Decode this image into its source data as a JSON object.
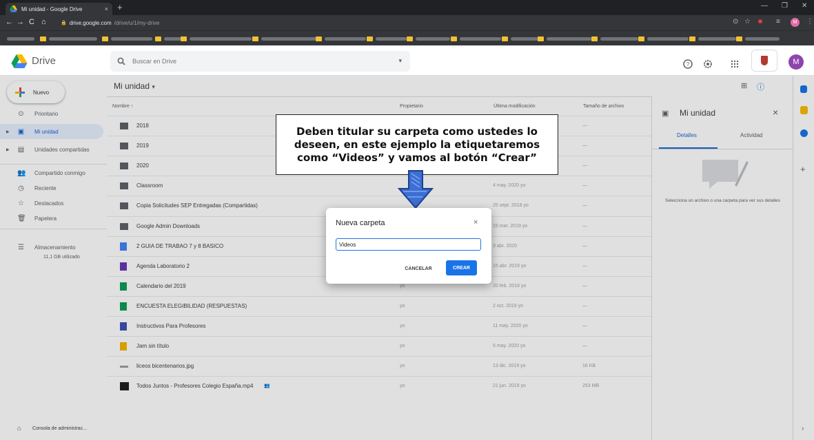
{
  "browser": {
    "tab_title": "Mi unidad - Google Drive",
    "tab_close": "×",
    "new_tab": "+",
    "url_host": "drive.google.com",
    "url_path": "/drive/u/1/my-drive",
    "profile_initial": "M"
  },
  "header": {
    "brand": "Drive",
    "search_placeholder": "Buscar en Drive",
    "user_initial": "M"
  },
  "sidebar": {
    "new_label": "Nuevo",
    "items": [
      {
        "label": "Prioritario",
        "icon": "check-circle-icon"
      },
      {
        "label": "Mi unidad",
        "icon": "my-drive-icon"
      },
      {
        "label": "Unidades compartidas",
        "icon": "shared-drives-icon"
      },
      {
        "label": "Compartido conmigo",
        "icon": "people-icon"
      },
      {
        "label": "Reciente",
        "icon": "clock-icon"
      },
      {
        "label": "Destacados",
        "icon": "star-icon"
      },
      {
        "label": "Papelera",
        "icon": "trash-icon"
      },
      {
        "label": "Almacenamiento",
        "icon": "storage-icon"
      }
    ],
    "storage_used": "11,1 GB utilizado",
    "admin_console": "Consola de administrac..."
  },
  "main": {
    "title": "Mi unidad",
    "columns": {
      "name": "Nombre",
      "owner": "Propietario",
      "modified": "Última modificación",
      "size": "Tamaño de archivo"
    },
    "rows": [
      {
        "name": "2018",
        "icon": "folder-icon",
        "owner": "",
        "modified": "",
        "size": "—"
      },
      {
        "name": "2019",
        "icon": "folder-icon",
        "owner": "",
        "modified": "",
        "size": "—"
      },
      {
        "name": "2020",
        "icon": "folder-icon",
        "owner": "",
        "modified": "",
        "size": "—"
      },
      {
        "name": "Classroom",
        "icon": "folder-icon",
        "owner": "",
        "modified": "4 may. 2020 yo",
        "size": "—"
      },
      {
        "name": "Copia Solicitudes SEP Entregadas (Compartidas)",
        "icon": "folder-icon",
        "owner": "",
        "modified": "25 sept. 2018 yo",
        "size": "—"
      },
      {
        "name": "Google Admin Downloads",
        "icon": "folder-icon",
        "owner": "",
        "modified": "15 mar. 2019 yo",
        "size": "—"
      },
      {
        "name": "2 GUIA DE TRABAO 7 y 8 BASICO",
        "icon": "google-docs-icon",
        "owner": "",
        "modified": "3 abr. 2020",
        "size": "—"
      },
      {
        "name": "Agenda Laboratorio 2",
        "icon": "google-forms-icon",
        "owner": "",
        "modified": "15 abr. 2019 yo",
        "size": "—"
      },
      {
        "name": "Calendario del 2019",
        "icon": "google-sheets-icon",
        "owner": "yo",
        "modified": "20 feb. 2019 yo",
        "size": "—"
      },
      {
        "name": "ENCUESTA ELEGIBILIDAD (RESPUESTAS)",
        "icon": "google-sheets-icon",
        "owner": "yo",
        "modified": "2 oct. 2019 yo",
        "size": "—"
      },
      {
        "name": "Instructivos Para Profesores",
        "icon": "google-sites-icon",
        "owner": "yo",
        "modified": "11 may. 2020 yo",
        "size": "—"
      },
      {
        "name": "Jam sin título",
        "icon": "jamboard-icon",
        "owner": "yo",
        "modified": "5 may. 2020 yo",
        "size": "—"
      },
      {
        "name": "liceos bicentenarios.jpg",
        "icon": "image-file-icon",
        "owner": "yo",
        "modified": "13 dic. 2019 yo",
        "size": "16 KB"
      },
      {
        "name": "Todos Juntos - Profesores Colegio España.mp4",
        "icon": "video-file-icon",
        "owner": "yo",
        "modified": "21 jun. 2019 yo",
        "size": "253 MB"
      }
    ]
  },
  "details_panel": {
    "title": "Mi unidad",
    "tab_details": "Detalles",
    "tab_activity": "Actividad",
    "hint": "Selecciona un archivo o una carpeta para ver sus detalles"
  },
  "callout": {
    "text": "Deben titular su carpeta como ustedes lo deseen, en este ejemplo la etiquetaremos como “Videos” y vamos al botón “Crear”"
  },
  "dialog": {
    "title": "Nueva carpeta",
    "input_value": "Videos",
    "cancel": "CANCELAR",
    "create": "CREAR"
  },
  "colors": {
    "accent": "#1a73e8",
    "active_nav_bg": "#e8f0fe",
    "chrome_dark": "#35363a"
  }
}
